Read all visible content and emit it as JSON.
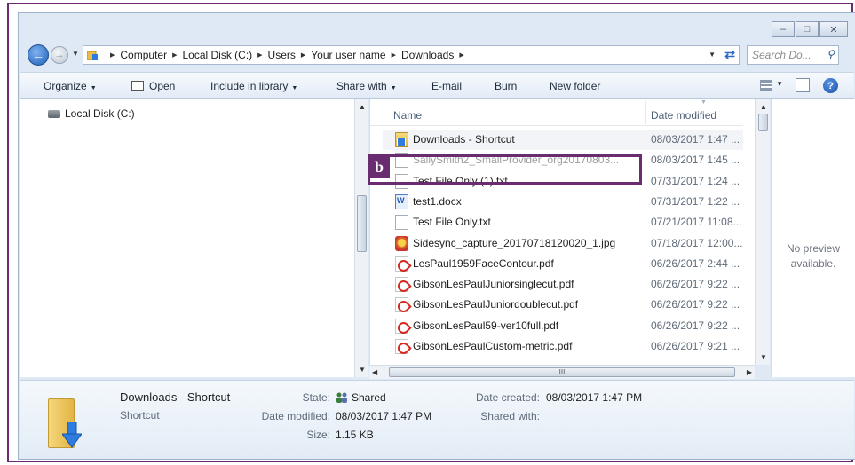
{
  "accent_color": "#6a2c70",
  "window_controls": {
    "minimize": "minimize-icon",
    "maximize": "maximize-icon",
    "close": "close-icon"
  },
  "address": {
    "breadcrumbs": [
      "Computer",
      "Local Disk (C:)",
      "Users",
      "Your user name",
      "Downloads"
    ],
    "search_placeholder": "Search Do..."
  },
  "toolbar": {
    "organize": "Organize",
    "open": "Open",
    "include_in_library": "Include in library",
    "share_with": "Share with",
    "email": "E-mail",
    "burn": "Burn",
    "new_folder": "New folder",
    "help": "?"
  },
  "nav": {
    "items": [
      {
        "label": "Local Disk (C:)",
        "icon": "drive-icon"
      }
    ]
  },
  "file_list": {
    "columns": {
      "name": "Name",
      "date": "Date modified"
    },
    "rows": [
      {
        "name": "Downloads - Shortcut",
        "date": "08/03/2017 1:47 ...",
        "icon": "shortcut-folder-icon"
      },
      {
        "name": "SallySmith2_SmallProvider_org20170803...",
        "date": "08/03/2017 1:45 ...",
        "icon": "file-icon"
      },
      {
        "name": "Test File Only (1).txt",
        "date": "07/31/2017 1:24 ...",
        "icon": "text-file-icon"
      },
      {
        "name": "test1.docx",
        "date": "07/31/2017 1:22 ...",
        "icon": "word-doc-icon"
      },
      {
        "name": "Test File Only.txt",
        "date": "07/21/2017 11:08...",
        "icon": "text-file-icon"
      },
      {
        "name": "Sidesync_capture_20170718120020_1.jpg",
        "date": "07/18/2017 12:00...",
        "icon": "image-file-icon"
      },
      {
        "name": "LesPaul1959FaceContour.pdf",
        "date": "06/26/2017 2:44 ...",
        "icon": "pdf-icon"
      },
      {
        "name": "GibsonLesPaulJuniorsinglecut.pdf",
        "date": "06/26/2017 9:22 ...",
        "icon": "pdf-icon"
      },
      {
        "name": "GibsonLesPaulJuniordoublecut.pdf",
        "date": "06/26/2017 9:22 ...",
        "icon": "pdf-icon"
      },
      {
        "name": "GibsonLesPaul59-ver10full.pdf",
        "date": "06/26/2017 9:22 ...",
        "icon": "pdf-icon"
      },
      {
        "name": "GibsonLesPaulCustom-metric.pdf",
        "date": "06/26/2017 9:21 ...",
        "icon": "pdf-icon"
      }
    ],
    "hscroll_grip": "III"
  },
  "annotation": {
    "label": "b"
  },
  "preview": {
    "line1": "No preview",
    "line2": "available."
  },
  "details": {
    "name": "Downloads - Shortcut",
    "type": "Shortcut",
    "state_label": "State:",
    "state_value": "Shared",
    "date_modified_label": "Date modified:",
    "date_modified_value": "08/03/2017 1:47 PM",
    "size_label": "Size:",
    "size_value": "1.15 KB",
    "date_created_label": "Date created:",
    "date_created_value": "08/03/2017 1:47 PM",
    "shared_with_label": "Shared with:"
  }
}
